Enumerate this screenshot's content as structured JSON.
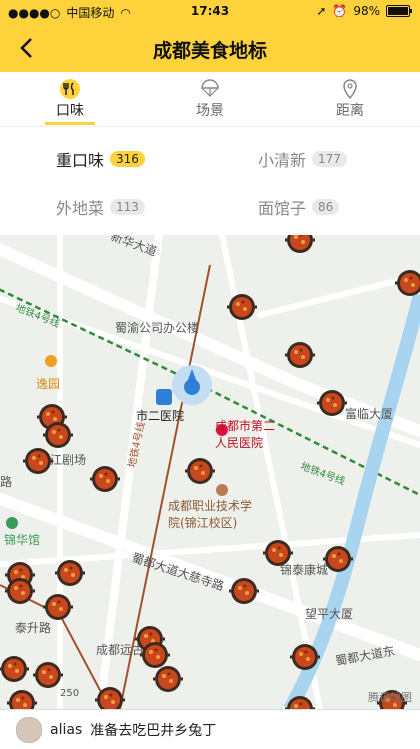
{
  "status": {
    "carrier": "中国移动",
    "time": "17:43",
    "battery_text": "98%",
    "battery_level": 0.98
  },
  "nav": {
    "title": "成都美食地标"
  },
  "tabs": [
    {
      "label": "口味",
      "icon": "utensils-icon",
      "active": true
    },
    {
      "label": "场景",
      "icon": "parachute-icon",
      "active": false
    },
    {
      "label": "距离",
      "icon": "location-pin-icon",
      "active": false
    }
  ],
  "categories": [
    {
      "label": "重口味",
      "count": "316",
      "active": true
    },
    {
      "label": "小清新",
      "count": "177",
      "active": false
    },
    {
      "label": "外地菜",
      "count": "113",
      "active": false
    },
    {
      "label": "面馆子",
      "count": "86",
      "active": false
    }
  ],
  "map": {
    "labels": {
      "xinhua": "新华大道",
      "metro_left": "地铁4号线",
      "metro_right": "地铁4号线",
      "metro_vert": "地铁4号线",
      "shuyu": "蜀渝公司办公楼",
      "yiyuan": "逸园",
      "shier": "市二医院",
      "jiangju": "江剧场",
      "second_hospital": "成都市第二人民医院",
      "fulin": "富临大厦",
      "vocational": "成都职业技术学院(锦江校区)",
      "huaguan": "锦华馆",
      "shudu_ci": "蜀都大道大慈寺路",
      "xiehe": "锦泰康城",
      "wangping": "望平大厦",
      "shudu_east": "蜀都大道东",
      "yuangu": "成都远古",
      "road": "路",
      "taisheng": "泰升路"
    },
    "scale": "250",
    "credit": "腾讯地图"
  },
  "activity": {
    "user": "alias",
    "text": "准备去吃巴井乡兔丁"
  }
}
